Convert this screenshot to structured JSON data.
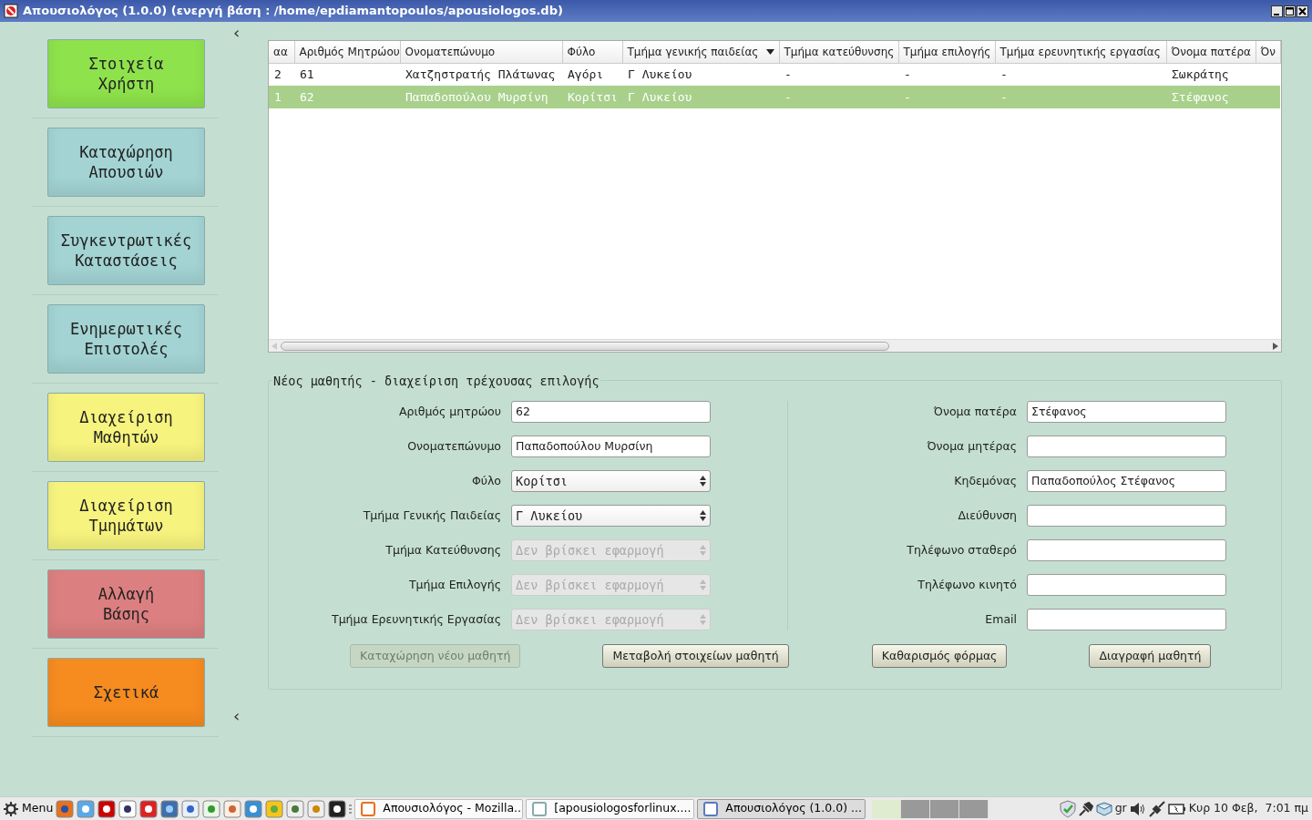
{
  "window": {
    "title": "Απουσιολόγος (1.0.0) (ενεργή βάση : /home/epdiamantopoulos/apousiologos.db)"
  },
  "sidebar": {
    "collapse_top": "‹",
    "collapse_bottom": "‹",
    "buttons": [
      {
        "label": "Στοιχεία\nΧρήστη",
        "color": "#8ee24c"
      },
      {
        "label": "Καταχώρηση\nΑπουσιών",
        "color": "#a3d3d3"
      },
      {
        "label": "Συγκεντρωτικές\nΚαταστάσεις",
        "color": "#a3d3d3"
      },
      {
        "label": "Ενημερωτικές\nΕπιστολές",
        "color": "#a3d3d3"
      },
      {
        "label": "Διαχείριση\nΜαθητών",
        "color": "#f6f37e"
      },
      {
        "label": "Διαχείριση\nΤμημάτων",
        "color": "#f6f37e"
      },
      {
        "label": "Αλλαγή\nΒάσης",
        "color": "#dc7f80"
      },
      {
        "label": "Σχετικά",
        "color": "#f68b1f"
      }
    ]
  },
  "table": {
    "columns": [
      {
        "label": "αα",
        "sorted": false
      },
      {
        "label": "Αριθμός Μητρώου",
        "sorted": false
      },
      {
        "label": "Ονοματεπώνυμο",
        "sorted": false
      },
      {
        "label": "Φύλο",
        "sorted": false
      },
      {
        "label": "Τμήμα γενικής παιδείας",
        "sorted": true
      },
      {
        "label": "Τμήμα κατεύθυνσης",
        "sorted": false
      },
      {
        "label": "Τμήμα επιλογής",
        "sorted": false
      },
      {
        "label": "Τμήμα ερευνητικής εργασίας",
        "sorted": false
      },
      {
        "label": "Όνομα πατέρα",
        "sorted": false
      },
      {
        "label": "Όν",
        "sorted": false
      }
    ],
    "rows": [
      {
        "selected": false,
        "cells": [
          "2",
          "61",
          "Χατζηστρατής Πλάτωνας",
          "Αγόρι",
          "Γ Λυκείου",
          "-",
          "-",
          "-",
          "Σωκράτης"
        ]
      },
      {
        "selected": true,
        "cells": [
          "1",
          "62",
          "Παπαδοπούλου Μυρσίνη",
          "Κορίτσι",
          "Γ Λυκείου",
          "-",
          "-",
          "-",
          "Στέφανος"
        ]
      }
    ]
  },
  "form": {
    "title": "Νέος μαθητής - διαχείριση τρέχουσας επιλογής",
    "left_fields": [
      {
        "label": "Αριθμός μητρώου",
        "kind": "text",
        "value": "62",
        "disabled": false
      },
      {
        "label": "Ονοματεπώνυμο",
        "kind": "text",
        "value": "Παπαδοπούλου Μυρσίνη",
        "disabled": false
      },
      {
        "label": "Φύλο",
        "kind": "select",
        "value": "Κορίτσι",
        "disabled": false
      },
      {
        "label": "Τμήμα Γενικής Παιδείας",
        "kind": "select",
        "value": "Γ Λυκείου",
        "disabled": false
      },
      {
        "label": "Τμήμα Κατεύθυνσης",
        "kind": "select",
        "value": "Δεν βρίσκει εφαρμογή",
        "disabled": true
      },
      {
        "label": "Τμήμα Επιλογής",
        "kind": "select",
        "value": "Δεν βρίσκει εφαρμογή",
        "disabled": true
      },
      {
        "label": "Τμήμα Ερευνητικής Εργασίας",
        "kind": "select",
        "value": "Δεν βρίσκει εφαρμογή",
        "disabled": true
      }
    ],
    "right_fields": [
      {
        "label": "Όνομα πατέρα",
        "kind": "text",
        "value": "Στέφανος",
        "disabled": false
      },
      {
        "label": "Όνομα μητέρας",
        "kind": "text",
        "disabled": false
      },
      {
        "label": "Κηδεμόνας",
        "kind": "text",
        "value": "Παπαδοπούλος Στέφανος",
        "disabled": false
      },
      {
        "label": "Διεύθυνση",
        "kind": "text",
        "disabled": false
      },
      {
        "label": "Τηλέφωνο σταθερό",
        "kind": "text",
        "disabled": false
      },
      {
        "label": "Τηλέφωνο κινητό",
        "kind": "text",
        "disabled": false
      },
      {
        "label": "Email",
        "kind": "text",
        "disabled": false
      }
    ],
    "buttons": [
      {
        "label": "Καταχώρηση νέου μαθητή",
        "disabled": true
      },
      {
        "label": "Μεταβολή στοιχείων μαθητή",
        "disabled": false
      },
      {
        "label": "Καθαρισμός φόρμας",
        "disabled": false
      },
      {
        "label": "Διαγραφή μαθητή",
        "disabled": false
      }
    ]
  },
  "taskbar": {
    "menu": "Menu",
    "tasks": [
      {
        "label": "Απουσιολόγος - Mozilla...",
        "selected": false
      },
      {
        "label": "[apousiologosforlinux....",
        "selected": false
      },
      {
        "label": "Απουσιολόγος (1.0.0) ...",
        "selected": true
      }
    ],
    "workspaces": [
      {
        "selected": true
      },
      {
        "selected": false
      },
      {
        "selected": false
      },
      {
        "selected": false
      }
    ],
    "keyboard": "gr",
    "clock": "Κυρ 10 Φεβ,  7:01 πμ"
  }
}
